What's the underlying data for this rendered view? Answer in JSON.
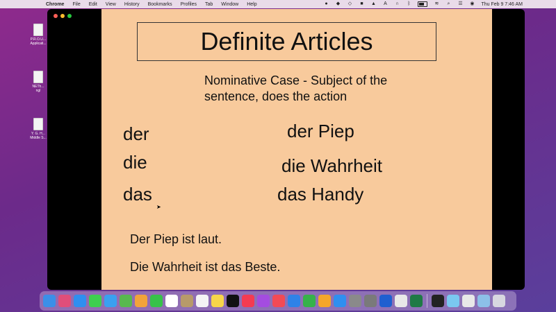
{
  "menubar": {
    "app_name": "Chrome",
    "items": [
      "File",
      "Edit",
      "View",
      "History",
      "Bookmarks",
      "Profiles",
      "Tab",
      "Window",
      "Help"
    ],
    "clock": "Thu Feb 9  7:46 AM"
  },
  "desktop": {
    "icons": [
      {
        "label": "P.R.O.U...\nApplicati..."
      },
      {
        "label": "NETh...\nngl"
      },
      {
        "label": "Y. G. H...\nMiddle S..."
      }
    ]
  },
  "slide": {
    "title": "Definite Articles",
    "subtitle": "Nominative Case - Subject of the sentence, does the action",
    "articles": [
      "der",
      "die",
      "das"
    ],
    "examples": [
      "der Piep",
      "die Wahrheit",
      "das Handy"
    ],
    "sentences": [
      "Der Piep ist laut.",
      "Die Wahrheit ist das Beste."
    ]
  },
  "dock": {
    "icons": [
      {
        "name": "finder",
        "color": "#3b8fe8"
      },
      {
        "name": "launchpad",
        "color": "#e04e7a"
      },
      {
        "name": "safari",
        "color": "#2f8ff0"
      },
      {
        "name": "messages",
        "color": "#3ecf4f"
      },
      {
        "name": "mail",
        "color": "#3aa0f0"
      },
      {
        "name": "maps",
        "color": "#58b84f"
      },
      {
        "name": "photos",
        "color": "#f2a33a"
      },
      {
        "name": "facetime",
        "color": "#37c24a"
      },
      {
        "name": "calendar",
        "color": "#ffffff"
      },
      {
        "name": "contacts",
        "color": "#b79a6a"
      },
      {
        "name": "reminders",
        "color": "#f4f4f4"
      },
      {
        "name": "notes",
        "color": "#f7d54a"
      },
      {
        "name": "apple-tv",
        "color": "#111111"
      },
      {
        "name": "music",
        "color": "#f43b52"
      },
      {
        "name": "podcasts",
        "color": "#a44ce0"
      },
      {
        "name": "news",
        "color": "#f24a55"
      },
      {
        "name": "keynote",
        "color": "#2f82e8"
      },
      {
        "name": "numbers",
        "color": "#36b24a"
      },
      {
        "name": "pages",
        "color": "#f4a62a"
      },
      {
        "name": "app-store",
        "color": "#2f8ff0"
      },
      {
        "name": "disk-utility",
        "color": "#8a8a8a"
      },
      {
        "name": "settings",
        "color": "#7a7a7a"
      },
      {
        "name": "proxy",
        "color": "#1f5fd0"
      },
      {
        "name": "chrome",
        "color": "#e8e8e8"
      },
      {
        "name": "excel",
        "color": "#1e7a45"
      },
      {
        "name": "headphones",
        "color": "#222222"
      },
      {
        "name": "preview",
        "color": "#7ac8f0"
      },
      {
        "name": "screenshot",
        "color": "#e8e8e8"
      },
      {
        "name": "downloads",
        "color": "#8cc0e8"
      },
      {
        "name": "trash",
        "color": "#d8d8e0"
      }
    ]
  }
}
